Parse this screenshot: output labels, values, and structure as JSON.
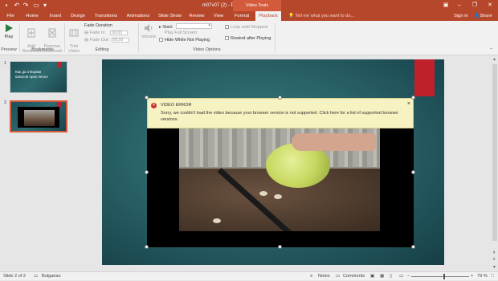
{
  "window": {
    "title": "m07v07 (2) - PowerPoint",
    "context_group": "Video Tools",
    "minimize": "–",
    "restore": "❐",
    "close": "✕"
  },
  "tabs": [
    {
      "label": "File"
    },
    {
      "label": "Home"
    },
    {
      "label": "Insert"
    },
    {
      "label": "Design"
    },
    {
      "label": "Transitions"
    },
    {
      "label": "Animations"
    },
    {
      "label": "Slide Show"
    },
    {
      "label": "Review"
    },
    {
      "label": "View"
    },
    {
      "label": "Format"
    },
    {
      "label": "Playback"
    }
  ],
  "tell_me": "Tell me what you want to do...",
  "sign_in": "Sign in",
  "share": "Share",
  "ribbon": {
    "preview": {
      "play": "Play",
      "group": "Preview"
    },
    "bookmarks": {
      "add": "Add\nBookmark",
      "remove": "Remove\nBookmark",
      "group": "Bookmarks"
    },
    "editing": {
      "trim": "Trim\nVideo",
      "fade_duration": "Fade Duration",
      "fade_in_label": "Fade In:",
      "fade_in_value": "00,00",
      "fade_out_label": "Fade Out:",
      "fade_out_value": "00,00",
      "group": "Editing"
    },
    "video_options": {
      "volume": "Volume",
      "start_label": "Start:",
      "play_full_screen": "Play Full Screen",
      "hide_while_not_playing": "Hide While Not Playing",
      "loop_until_stopped": "Loop until Stopped",
      "rewind_after_playing": "Rewind after Playing",
      "group": "Video Options"
    }
  },
  "slides": [
    {
      "number": "1",
      "text": "Как да отворим кокосов орех лесно"
    },
    {
      "number": "2"
    }
  ],
  "video_error": {
    "title": "VIDEO ERROR",
    "message": "Sorry, we couldn't load the video because your browser version is not supported. Click here for a list of supported browser versions.",
    "close": "×"
  },
  "status": {
    "slide": "Slide 2 of 2",
    "language": "Bulgarian",
    "notes": "Notes",
    "comments": "Comments",
    "zoom": "79 %"
  },
  "colors": {
    "accent": "#b7472a",
    "slide_bg": "#2a6469",
    "error_bg": "#f7f2c2"
  }
}
